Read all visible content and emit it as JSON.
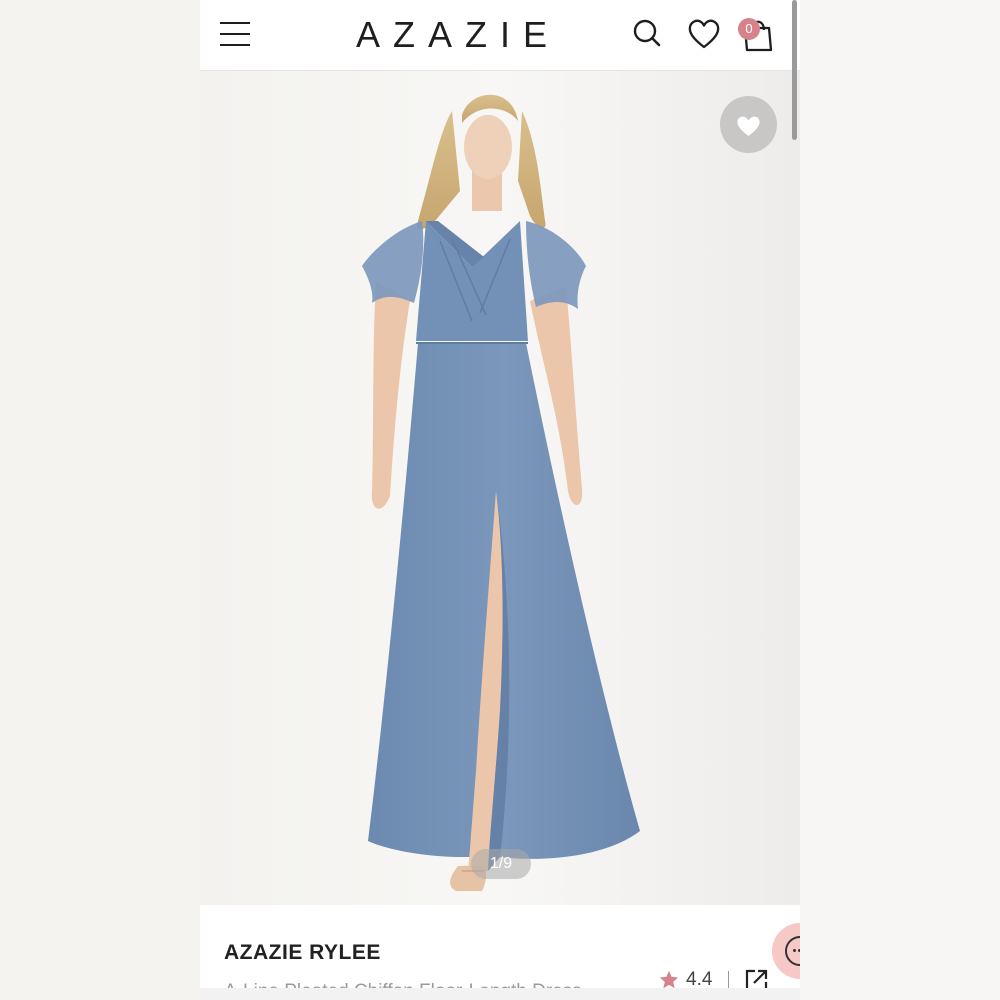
{
  "header": {
    "brand": "AZAZIE",
    "cart_count": "0"
  },
  "gallery": {
    "counter": "1/9"
  },
  "product": {
    "title": "AZAZIE RYLEE",
    "subtitle": "A-Line Pleated Chiffon Floor-Length Dress",
    "rating": "4.4"
  },
  "icons": {
    "menu": "hamburger-menu-icon",
    "search": "search-icon",
    "wishlist": "heart-outline-icon",
    "bag": "shopping-bag-icon",
    "favorite": "heart-filled-icon",
    "star": "star-icon",
    "share": "share-icon",
    "chat": "chat-icon"
  },
  "colors": {
    "badge": "#d7828b",
    "dress": "#7290b6",
    "star": "#d7828b"
  }
}
